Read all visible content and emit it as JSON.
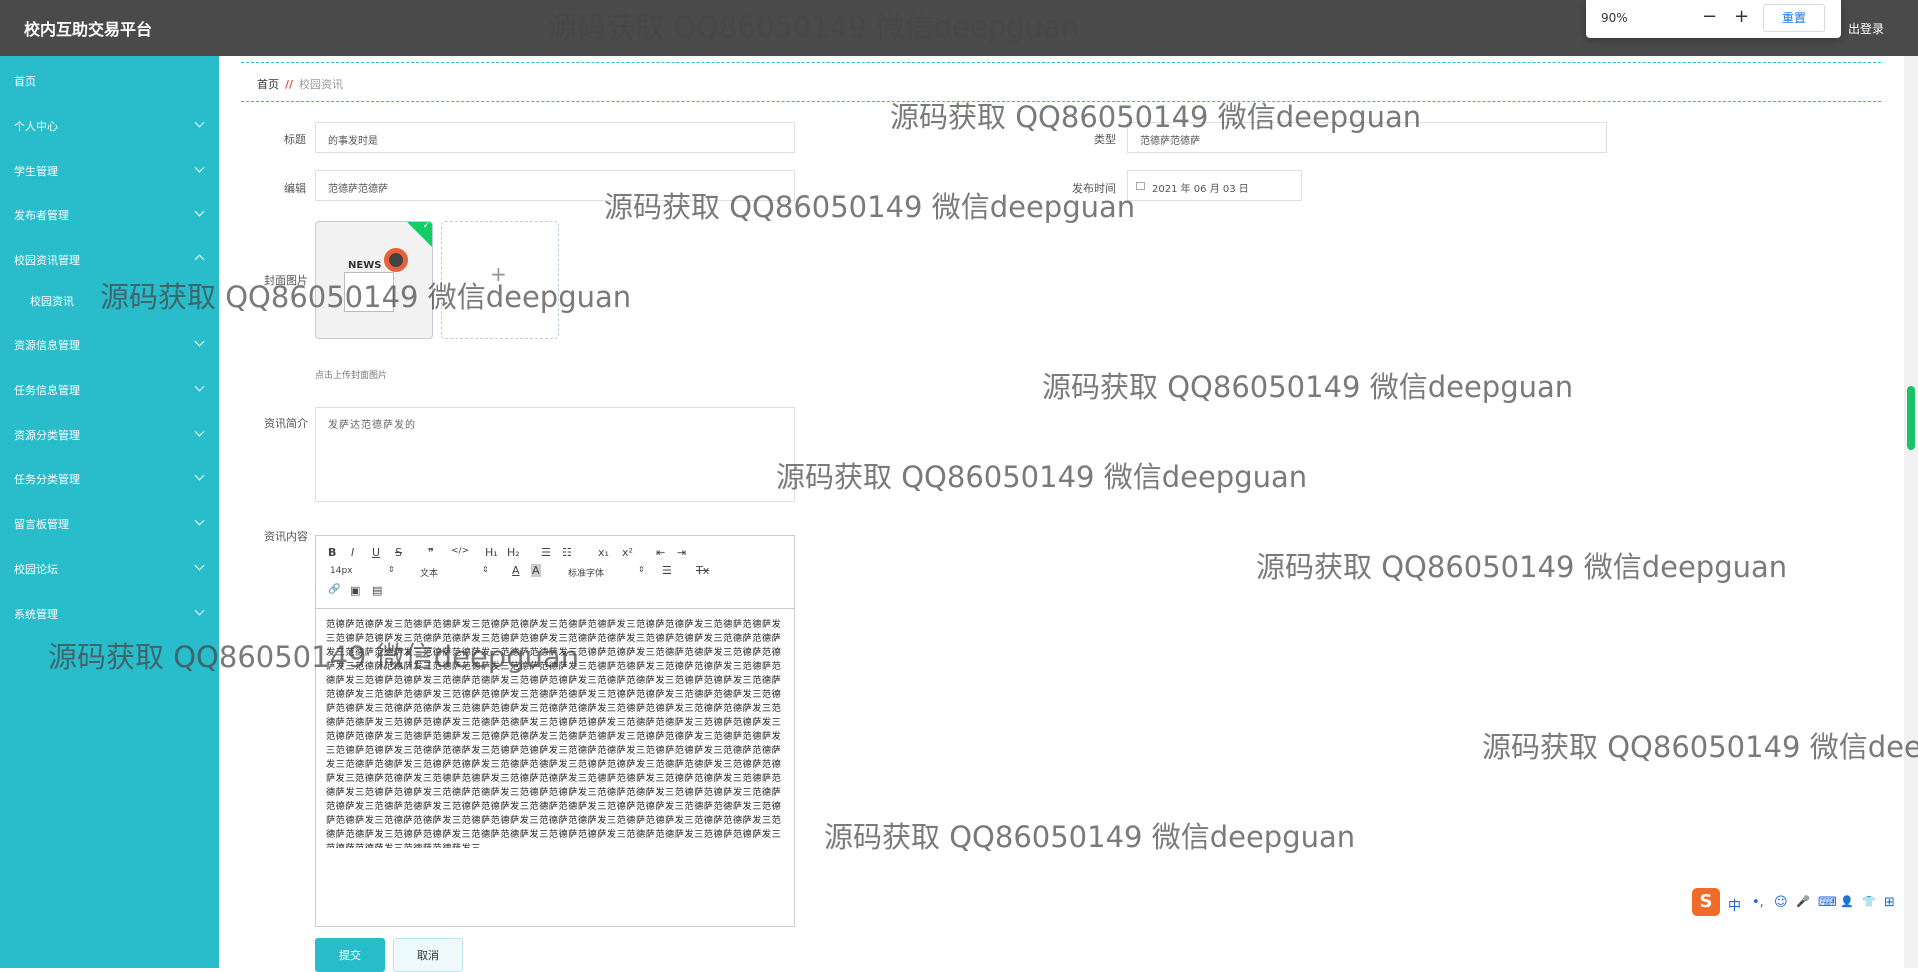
{
  "header": {
    "title": "校内互助交易平台",
    "logout": "出登录"
  },
  "zoom": {
    "value": "90%",
    "minus": "−",
    "plus": "+",
    "reset": "重置"
  },
  "sidebar": {
    "items": [
      {
        "label": "首页"
      },
      {
        "label": "个人中心"
      },
      {
        "label": "学生管理"
      },
      {
        "label": "发布者管理"
      },
      {
        "label": "校园资讯管理"
      },
      {
        "label": "校园资讯"
      },
      {
        "label": "资源信息管理"
      },
      {
        "label": "任务信息管理"
      },
      {
        "label": "资源分类管理"
      },
      {
        "label": "任务分类管理"
      },
      {
        "label": "留言板管理"
      },
      {
        "label": "校园论坛"
      },
      {
        "label": "系统管理"
      }
    ]
  },
  "breadcrumb": {
    "home": "首页",
    "sep": "//",
    "current": "校园资讯"
  },
  "form": {
    "title_label": "标题",
    "title_value": "的事发时是",
    "type_label": "类型",
    "type_value": "范德萨范德萨",
    "editor_label": "编辑",
    "editor_value": "范德萨范德萨",
    "time_label": "发布时间",
    "time_value": "2021 年 06 月 03 日",
    "cover_label": "封面图片",
    "cover_badge": "✓",
    "cover_news": "NEWS",
    "upload_plus": "+",
    "upload_tip": "点击上传封面图片",
    "intro_label": "资讯简介",
    "intro_value": "发萨达范德萨发的",
    "content_label": "资讯内容",
    "content_text": "范德萨范德萨发三范德萨范德萨发三范德萨范德萨发三范德萨范德萨发三范德萨范德萨发三范德萨范德萨发三范德萨范德萨发三范德萨范德萨发三范德萨范德萨发三范德萨范德萨发三范德萨范德萨发三范德萨范德萨发三范德萨范德萨发三范德萨范德萨发三范德萨范德萨发三范德萨范德萨发三范德萨范德萨发三范德萨范德萨发三范德萨范德萨发三范德萨范德萨发三范德萨范德萨发三范德萨范德萨发三范德萨范德萨发三范德萨范德萨发三范德萨范德萨发三范德萨范德萨发三范德萨范德萨发三范德萨范德萨发三范德萨范德萨发三范德萨范德萨发三范德萨范德萨发三范德萨范德萨发三范德萨范德萨发三范德萨范德萨发三范德萨范德萨发三范德萨范德萨发三范德萨范德萨发三范德萨范德萨发三范德萨范德萨发三范德萨范德萨发三范德萨范德萨发三范德萨范德萨发三范德萨范德萨发三范德萨范德萨发三范德萨范德萨发三范德萨范德萨发三范德萨范德萨发三范德萨范德萨发三范德萨范德萨发三范德萨范德萨发三范德萨范德萨发三范德萨范德萨发三范德萨范德萨发三范德萨范德萨发三范德萨范德萨发三范德萨范德萨发三范德萨范德萨发三范德萨范德萨发三范德萨范德萨发三范德萨范德萨发三范德萨范德萨发三范德萨范德萨发三范德萨范德萨发三范德萨范德萨发三范德萨范德萨发三范德萨范德萨发三范德萨范德萨发三范德萨范德萨发三范德萨范德萨发三范德萨范德萨发三范德萨范德萨发三范德萨范德萨发三范德萨范德萨发三范德萨范德萨发三范德萨范德萨发三范德萨范德萨发三范德萨范德萨发三范德萨范德萨发三范德萨范德萨发三范德萨范德萨发三范德萨范德萨发三范德萨范德萨发三范德萨范德萨发三范德萨范德萨发三范德萨范德萨发三范德萨范德萨发三范德萨范德萨发三范德萨范德萨发三范德萨范德萨发三范德萨范德萨发三范德萨范德萨发三范德萨范德萨发三范德萨范德萨发三范德萨范德萨发三范德萨范德萨发三范德萨范德萨发三",
    "submit": "提交",
    "cancel": "取消"
  },
  "toolbar": {
    "bold": "B",
    "italic": "I",
    "underline": "U",
    "strike": "S",
    "quote": "❞",
    "code": "</>",
    "h1": "H₁",
    "h2": "H₂",
    "ol": "☰",
    "ul": "☷",
    "sub": "x₁",
    "sup": "x²",
    "outdent": "⇤",
    "indent": "⇥",
    "size": "14px",
    "font": "文本",
    "color": "A",
    "bg": "A",
    "family": "标准字体",
    "align": "☰",
    "clean": "Tx",
    "link": "🔗",
    "image": "▣",
    "video": "▤"
  },
  "watermark": "源码获取 QQ86050149 微信deepguan",
  "ime": {
    "logo": "S",
    "lang": "中",
    "items": [
      "•,",
      "☺",
      "🎤",
      "⌨",
      "👤",
      "👕",
      "⊞"
    ]
  }
}
